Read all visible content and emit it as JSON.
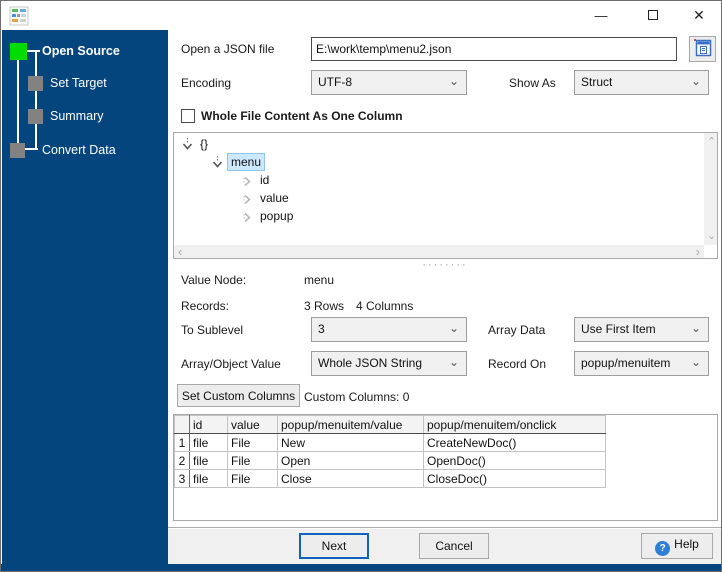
{
  "window": {
    "controls": {
      "minimize": "—",
      "close": "✕"
    }
  },
  "sidebar": {
    "steps": [
      {
        "label": "Open Source",
        "state": "active"
      },
      {
        "label": "Set Target",
        "state": "pending"
      },
      {
        "label": "Summary",
        "state": "pending"
      },
      {
        "label": "Convert Data",
        "state": "pending"
      }
    ],
    "colors": {
      "bg": "#04457E",
      "active_square": "#00DB00",
      "pending_square": "#828282"
    }
  },
  "source": {
    "open_file_label": "Open a JSON file",
    "file_path": "E:\\work\\temp\\menu2.json",
    "encoding_label": "Encoding",
    "encoding_value": "UTF-8",
    "show_as_label": "Show As",
    "show_as_value": "Struct",
    "whole_file_checkbox_label": "Whole File Content As One Column",
    "checkbox_checked": false
  },
  "tree": {
    "nodes": [
      {
        "label": "{}",
        "depth": 0,
        "expanded": true,
        "selected": false
      },
      {
        "label": "menu",
        "depth": 1,
        "expanded": true,
        "selected": true
      },
      {
        "label": "id",
        "depth": 2,
        "expanded": false,
        "selected": false
      },
      {
        "label": "value",
        "depth": 2,
        "expanded": false,
        "selected": false
      },
      {
        "label": "popup",
        "depth": 2,
        "expanded": false,
        "selected": false
      }
    ]
  },
  "details": {
    "value_node_label": "Value Node:",
    "value_node_value": "menu",
    "records_label": "Records:",
    "records_rows": "3 Rows",
    "records_columns": "4 Columns",
    "to_sublevel_label": "To Sublevel",
    "to_sublevel_value": "3",
    "array_data_label": "Array Data",
    "array_data_value": "Use First Item",
    "array_object_value_label": "Array/Object Value",
    "array_object_value_value": "Whole JSON String",
    "record_on_label": "Record On",
    "record_on_value": "popup/menuitem",
    "set_custom_columns_button": "Set Custom Columns",
    "custom_columns_text": "Custom Columns: 0"
  },
  "table": {
    "headers": [
      "",
      "id",
      "value",
      "popup/menuitem/value",
      "popup/menuitem/onclick"
    ],
    "rows": [
      [
        "1",
        "file",
        "File",
        "New",
        "CreateNewDoc()"
      ],
      [
        "2",
        "file",
        "File",
        "Open",
        "OpenDoc()"
      ],
      [
        "3",
        "file",
        "File",
        "Close",
        "CloseDoc()"
      ]
    ]
  },
  "footer": {
    "next_label": "Next",
    "cancel_label": "Cancel",
    "help_label": "Help"
  },
  "icons": {
    "combo_chevron": "⌄",
    "scroll_up": "⌃",
    "scroll_down": "⌄",
    "scroll_left": "‹",
    "scroll_right": "›",
    "splitter_dots": "········",
    "help_glyph": "?"
  }
}
